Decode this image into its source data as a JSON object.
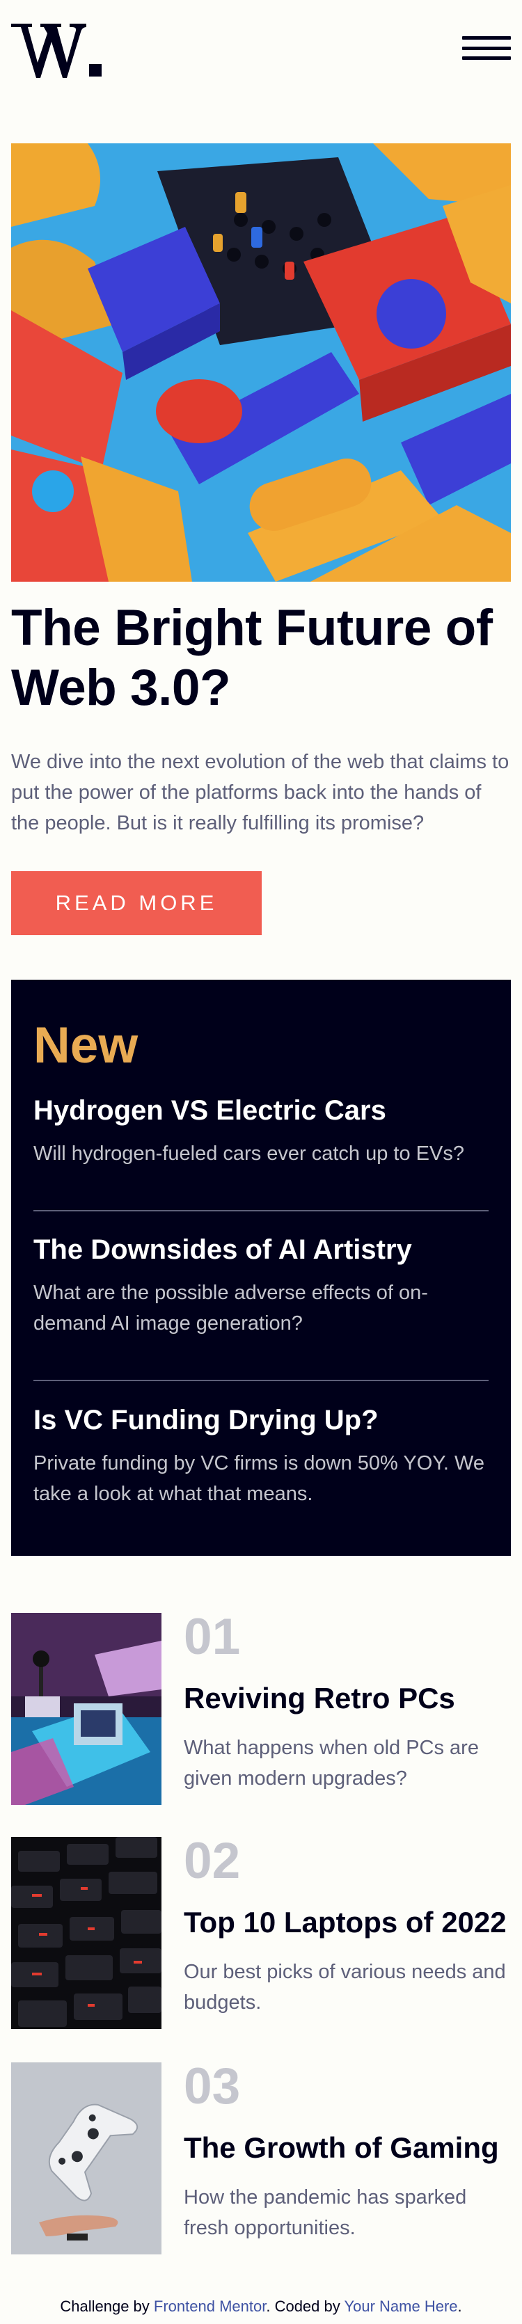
{
  "brand": {
    "logo_icon": "logo-w-mark"
  },
  "header": {
    "menu_icon": "hamburger-menu-icon"
  },
  "hero": {
    "title": "The Bright Future of Web 3.0?",
    "description": "We dive into the next evolution of the web that claims to put the power of the platforms back into the hands of the people. But is it really fulfilling its promise?",
    "button_label": "READ MORE",
    "accent_color": "#f15d51"
  },
  "new_section": {
    "heading": "New",
    "heading_color": "#e9ab53",
    "background_color": "#00001a",
    "items": [
      {
        "title": "Hydrogen VS Electric Cars",
        "description": "Will hydrogen-fueled cars ever catch up to EVs?"
      },
      {
        "title": "The Downsides of AI Artistry",
        "description": "What are the possible adverse effects of on-demand AI image generation?"
      },
      {
        "title": "Is VC Funding Drying Up?",
        "description": "Private funding by VC firms is down 50% YOY. We take a look at what that means."
      }
    ]
  },
  "numbered": {
    "items": [
      {
        "number": "01",
        "title": "Reviving Retro PCs",
        "description": "What happens when old PCs are given modern upgrades?"
      },
      {
        "number": "02",
        "title": "Top 10 Laptops of 2022",
        "description": "Our best picks of various needs and budgets."
      },
      {
        "number": "03",
        "title": "The Growth of Gaming",
        "description": "How the pandemic has sparked fresh opportunities."
      }
    ]
  },
  "footer": {
    "prefix": "Challenge by ",
    "link1": "Frontend Mentor",
    "middle": ". Coded by ",
    "link2": "Your Name Here",
    "suffix": "."
  }
}
